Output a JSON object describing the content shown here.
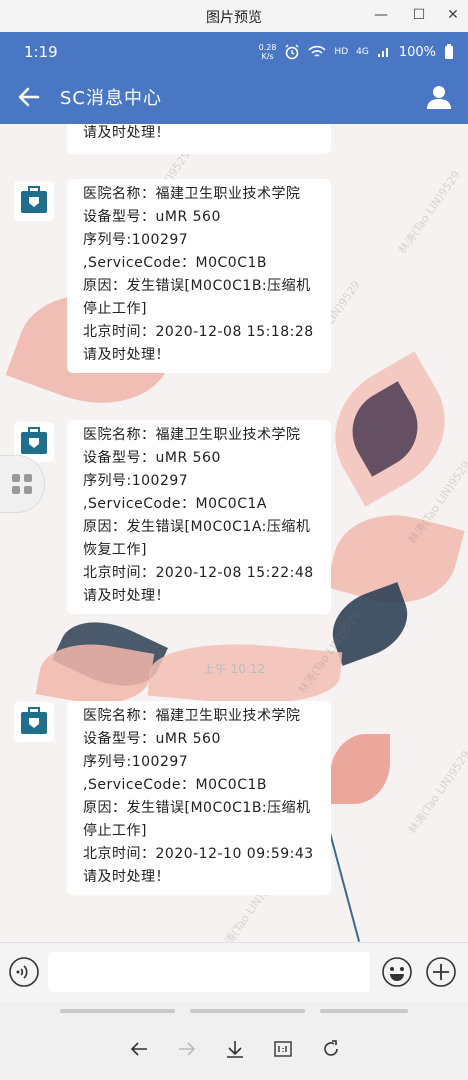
{
  "window": {
    "title": "图片预览",
    "minimize_glyph": "—",
    "maximize_glyph": "☐",
    "close_glyph": "✕"
  },
  "status_bar": {
    "time": "1:19",
    "net_speed_top": "0.28",
    "net_speed_bottom": "K/s",
    "hd": "HD",
    "signal": "4G",
    "battery": "100%"
  },
  "app_bar": {
    "title": "SC消息中心",
    "back_icon": "back-arrow-icon",
    "profile_icon": "person-icon"
  },
  "messages": [
    {
      "lines": [
        "请及时处理！"
      ]
    },
    {
      "lines": [
        "医院名称：福建卫生职业技术学院",
        "设备型号：uMR 560",
        "序列号:100297",
        ",ServiceCode：M0C0C1B",
        "原因：发生错误[M0C0C1B:压缩机停止工作]",
        "北京时间：2020-12-08 15:18:28",
        "请及时处理！"
      ]
    },
    {
      "lines": [
        "医院名称：福建卫生职业技术学院",
        "设备型号：uMR 560",
        "序列号:100297",
        ",ServiceCode：M0C0C1A",
        "原因：发生错误[M0C0C1A:压缩机恢复工作]",
        "北京时间：2020-12-08 15:22:48",
        "请及时处理！"
      ]
    },
    {
      "lines": [
        "医院名称：福建卫生职业技术学院",
        "设备型号：uMR 560",
        "序列号:100297",
        ",ServiceCode：M0C0C1B",
        "原因：发生错误[M0C0C1B:压缩机停止工作]",
        "北京时间：2020-12-10 09:59:43",
        "请及时处理！"
      ]
    }
  ],
  "timestamp": "上午 10:12",
  "watermark": "林涛(Tao LIN)9529",
  "colors": {
    "accent": "#4a77c4",
    "avatar_icon": "#1f6e8c"
  }
}
